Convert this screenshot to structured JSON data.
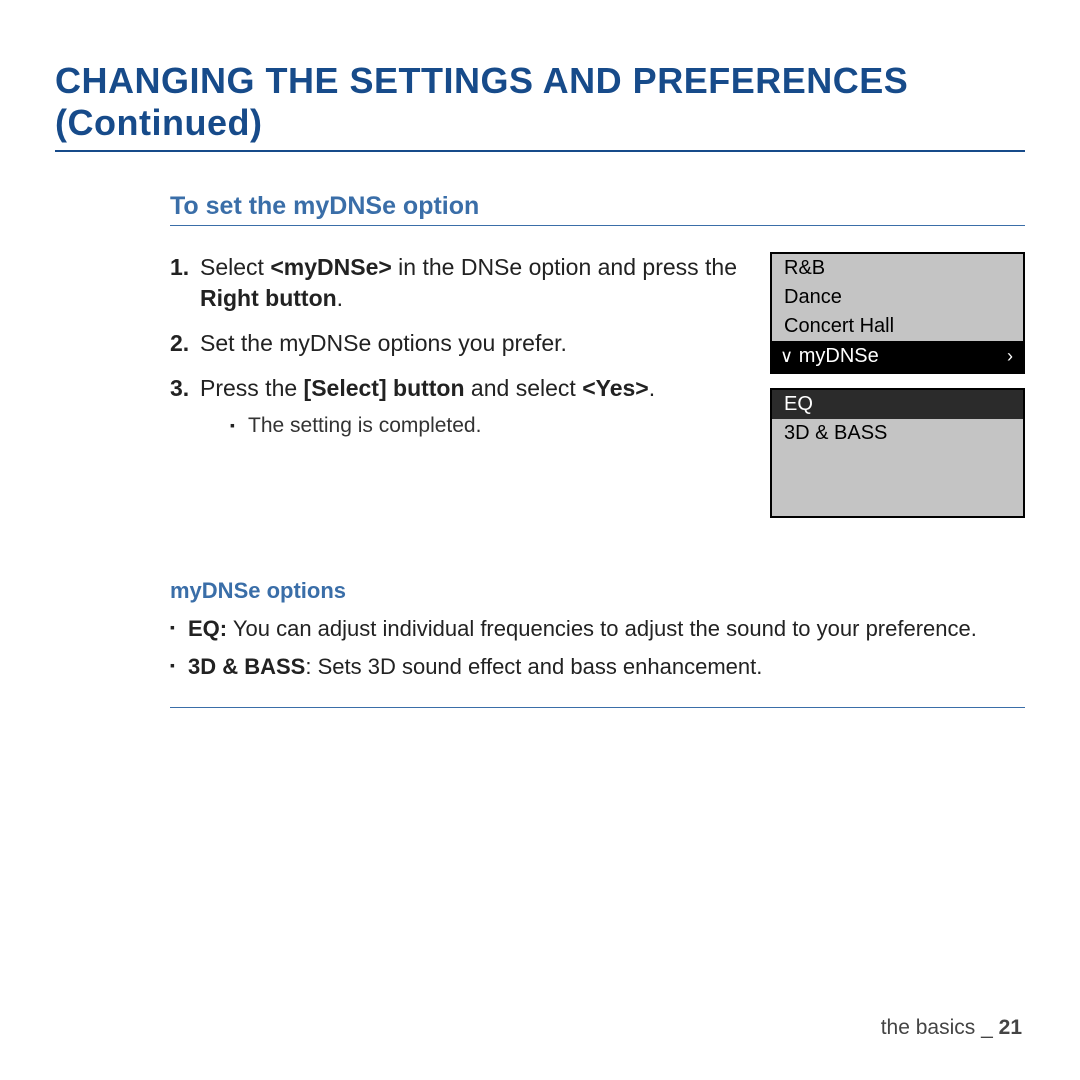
{
  "title": "CHANGING THE SETTINGS AND PREFERENCES (Continued)",
  "section_title": "To set the myDNSe option",
  "steps": {
    "s1_pre": "Select ",
    "s1_bold1": "<myDNSe>",
    "s1_mid": " in the DNSe option and press the ",
    "s1_bold2": "Right button",
    "s1_post": ".",
    "s2": "Set the myDNSe options you prefer.",
    "s3_pre": "Press the ",
    "s3_bold1": "[Select] button",
    "s3_mid": " and select ",
    "s3_bold2": "<Yes>",
    "s3_post": ".",
    "s3_sub": "The setting is completed."
  },
  "device": {
    "list1": {
      "a": "R&B",
      "b": "Dance",
      "c": "Concert Hall",
      "sel": "myDNSe"
    },
    "list2": {
      "hdr": "EQ",
      "a": "3D & BASS"
    }
  },
  "options_title": "myDNSe options",
  "options": {
    "eq_label": "EQ:",
    "eq_text": " You can adjust individual frequencies to adjust the sound to your preference.",
    "bass_label": "3D & BASS",
    "bass_text": ": Sets 3D sound effect and bass enhancement."
  },
  "footer": {
    "section": "the basics",
    "sep": " _ ",
    "page": "21"
  }
}
